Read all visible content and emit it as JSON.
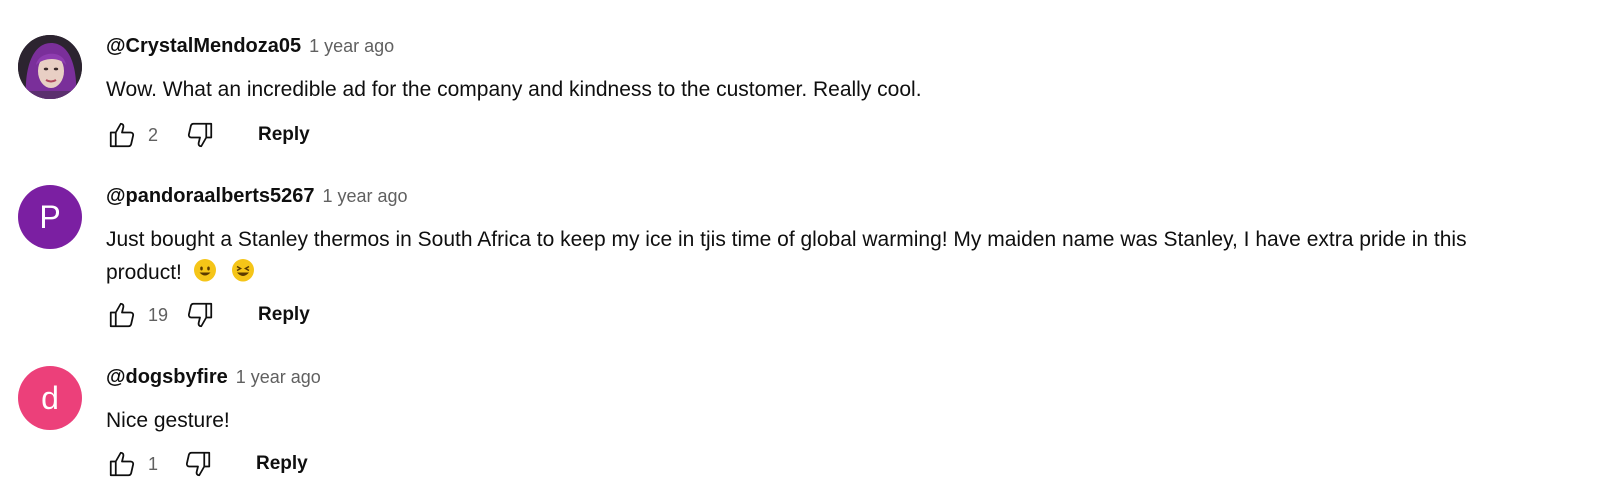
{
  "comments": [
    {
      "author": "@CrystalMendoza05",
      "time": "1 year ago",
      "text": "Wow. What an incredible ad for the company and kindness to the customer. Really cool.",
      "likes": "2",
      "reply_label": "Reply",
      "avatar": {
        "type": "photo",
        "bg": "#3b2f3f",
        "hair": "#7a2f9a"
      }
    },
    {
      "author": "@pandoraalberts5267",
      "time": "1 year ago",
      "text_line1": "Just bought a Stanley thermos in South Africa to keep my ice in tjis time of global warming! My maiden name was Stanley, I have extra pride in this",
      "text_line2": "product!",
      "emojis": [
        "smiley-face-emoji",
        "grinning-squinting-face-emoji"
      ],
      "likes": "19",
      "reply_label": "Reply",
      "avatar": {
        "type": "letter",
        "letter": "P",
        "bg": "#7b1fa2"
      }
    },
    {
      "author": "@dogsbyfire",
      "time": "1 year ago",
      "text": "Nice gesture!",
      "likes": "1",
      "reply_label": "Reply",
      "avatar": {
        "type": "letter",
        "letter": "d",
        "bg": "#ec407a"
      }
    }
  ],
  "colors": {
    "text": "#0f0f0f",
    "meta": "#606060",
    "background": "#ffffff",
    "emoji": "#f5c518"
  }
}
